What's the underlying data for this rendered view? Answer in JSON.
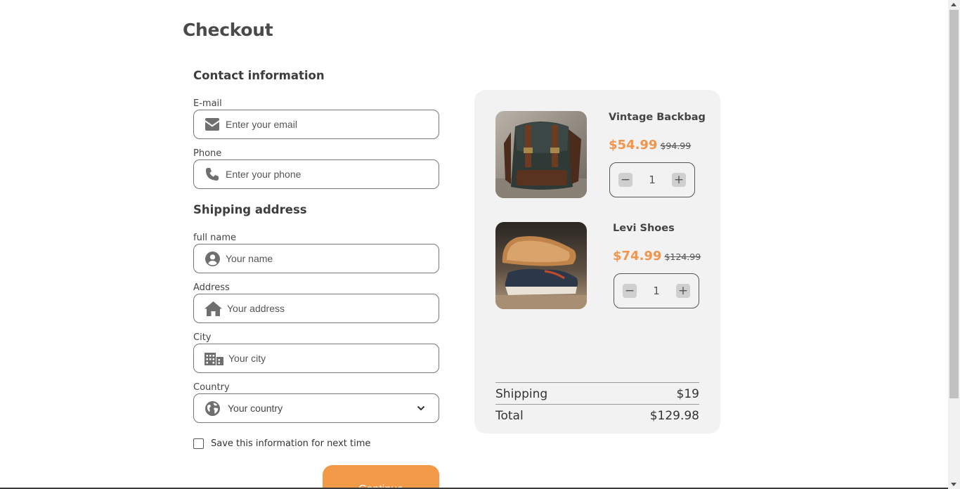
{
  "page": {
    "title": "Checkout"
  },
  "contact": {
    "heading": "Contact information",
    "email": {
      "label": "E-mail",
      "placeholder": "Enter your email",
      "value": "",
      "icon": "envelope-icon"
    },
    "phone": {
      "label": "Phone",
      "placeholder": "Enter your phone",
      "value": "",
      "icon": "phone-icon"
    }
  },
  "shipping": {
    "heading": "Shipping address",
    "full_name": {
      "label": "full name",
      "placeholder": "Your name",
      "value": "",
      "icon": "user-circle-icon"
    },
    "address": {
      "label": "Address",
      "placeholder": "Your address",
      "value": "",
      "icon": "home-icon"
    },
    "city": {
      "label": "City",
      "placeholder": "Your city",
      "value": "",
      "icon": "city-icon"
    },
    "country": {
      "label": "Country",
      "selected": "Your country",
      "icon": "globe-icon"
    }
  },
  "save_info": {
    "label": "Save this information for next time",
    "checked": false
  },
  "continue_button": {
    "label": "Continue",
    "color": "#f29a48"
  },
  "cart": {
    "items": [
      {
        "name": "Vintage Backbag",
        "price": "$54.99",
        "old_price": "$94.99",
        "quantity": "1",
        "image": "backpack-image"
      },
      {
        "name": "Levi Shoes",
        "price": "$74.99",
        "old_price": "$124.99",
        "quantity": "1",
        "image": "shoes-image"
      }
    ],
    "shipping_label": "Shipping",
    "shipping_value": "$19",
    "total_label": "Total",
    "total_value": "$129.98"
  },
  "colors": {
    "accent": "#f2954a",
    "panel": "#f2f2f2"
  }
}
